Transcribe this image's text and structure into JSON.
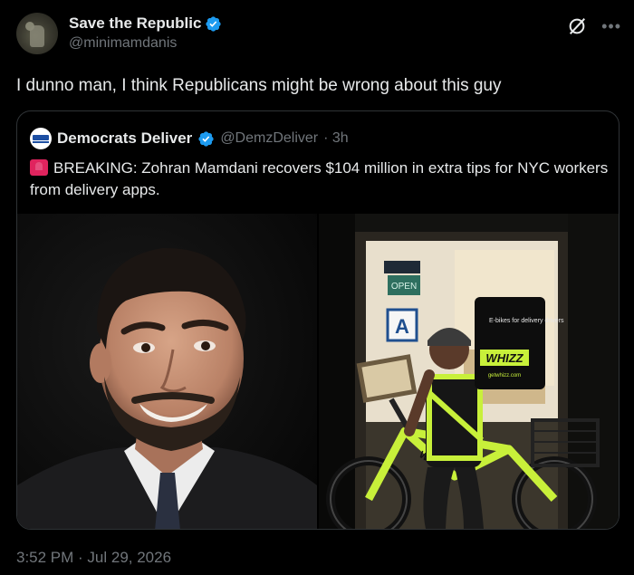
{
  "post": {
    "author_name": "Save the Republic",
    "author_handle": "@minimamdanis",
    "text": "I dunno man, I think Republicans might be wrong about this guy",
    "timestamp": "3:52 PM · Jul 29, 2026"
  },
  "quoted": {
    "author_name": "Democrats Deliver",
    "author_handle": "@DemzDeliver",
    "age": "· 3h",
    "avatar_text": "DEMOCRATS DELIVER",
    "text": "BREAKING: Zohran Mamdani recovers $104 million in extra tips for NYC workers from delivery apps.",
    "image_right_sign": "OPEN",
    "image_right_letter": "A",
    "bag_text": "E-bikes for delivery drivers",
    "bag_brand": "WHIZZ",
    "bag_url": "getwhizz.com",
    "bike_brand": "WHIZZ"
  },
  "icons": {
    "verified": "verified-badge-icon",
    "grok": "grok-icon",
    "more": "more-icon",
    "siren": "siren-emoji-icon"
  },
  "colors": {
    "background": "#000000",
    "verified_blue": "#1d9bf0",
    "muted_text": "#71767b",
    "border": "#2f3336"
  }
}
